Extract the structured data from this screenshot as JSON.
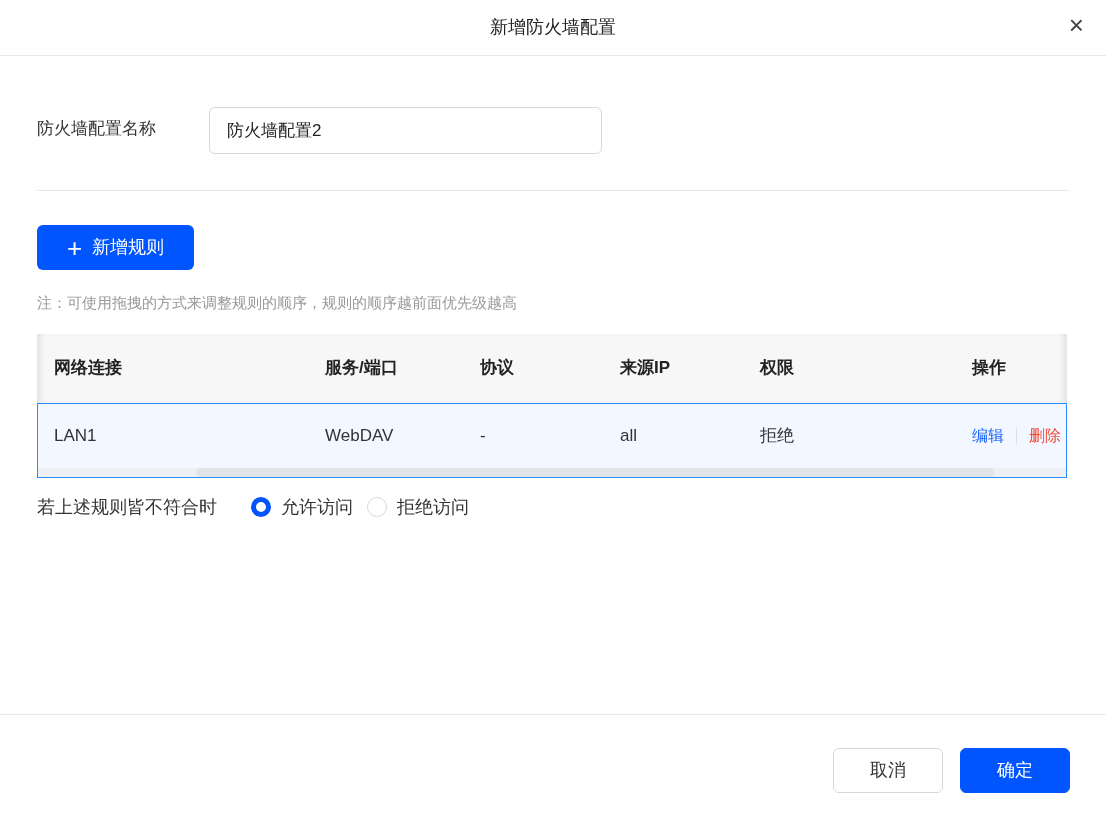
{
  "dialog": {
    "title": "新增防火墙配置",
    "close": "×"
  },
  "name_field": {
    "label": "防火墙配置名称",
    "value": "防火墙配置2"
  },
  "add_button": {
    "icon": "+",
    "label": "新增规则"
  },
  "note": "注：可使用拖拽的方式来调整规则的顺序，规则的顺序越前面优先级越高",
  "table": {
    "columns": [
      "网络连接",
      "服务/端口",
      "协议",
      "来源IP",
      "权限",
      "操作"
    ],
    "rows": [
      {
        "selected": true,
        "cells": [
          "LAN1",
          "WebDAV",
          "-",
          "all",
          "拒绝"
        ],
        "actions": [
          {
            "kind": "edit",
            "label": "编辑"
          },
          {
            "kind": "delete",
            "label": "删除"
          }
        ]
      }
    ]
  },
  "default_policy": {
    "label": "若上述规则皆不符合时",
    "options": [
      {
        "label": "允许访问",
        "selected": true
      },
      {
        "label": "拒绝访问",
        "selected": false
      }
    ]
  },
  "footer": {
    "buttons": [
      {
        "kind": "secondary",
        "label": "取消"
      },
      {
        "kind": "primary",
        "label": "确定"
      }
    ]
  }
}
